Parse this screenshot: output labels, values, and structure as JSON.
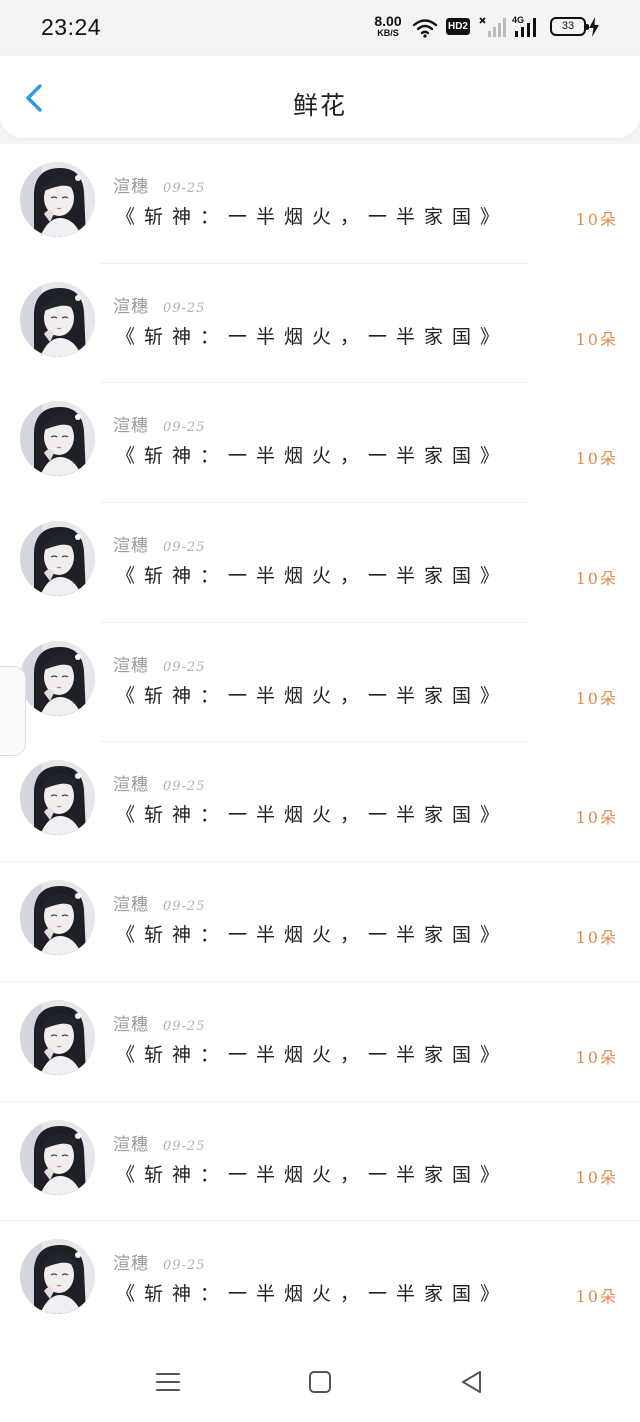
{
  "status_bar": {
    "time": "23:24",
    "net_speed_value": "8.00",
    "net_speed_unit": "KB/S",
    "hd_badge": "HD2",
    "network_type": "4G",
    "battery_level": "33",
    "icons": [
      "wifi-icon",
      "hd-voice-icon",
      "signal-off-icon",
      "signal-4g-icon",
      "battery-icon",
      "charging-icon"
    ]
  },
  "header": {
    "title": "鲜花",
    "back_icon": "chevron-left-icon",
    "accent_color": "#2f97e0"
  },
  "items": [
    {
      "sender": "渲穗",
      "date": "09-25",
      "book": "《斩神：一半烟火，一半家国》",
      "count": "10朵"
    },
    {
      "sender": "渲穗",
      "date": "09-25",
      "book": "《斩神：一半烟火，一半家国》",
      "count": "10朵"
    },
    {
      "sender": "渲穗",
      "date": "09-25",
      "book": "《斩神：一半烟火，一半家国》",
      "count": "10朵"
    },
    {
      "sender": "渲穗",
      "date": "09-25",
      "book": "《斩神：一半烟火，一半家国》",
      "count": "10朵"
    },
    {
      "sender": "渲穗",
      "date": "09-25",
      "book": "《斩神：一半烟火，一半家国》",
      "count": "10朵"
    },
    {
      "sender": "渲穗",
      "date": "09-25",
      "book": "《斩神：一半烟火，一半家国》",
      "count": "10朵"
    },
    {
      "sender": "渲穗",
      "date": "09-25",
      "book": "《斩神：一半烟火，一半家国》",
      "count": "10朵"
    },
    {
      "sender": "渲穗",
      "date": "09-25",
      "book": "《斩神：一半烟火，一半家国》",
      "count": "10朵"
    },
    {
      "sender": "渲穗",
      "date": "09-25",
      "book": "《斩神：一半烟火，一半家国》",
      "count": "10朵"
    },
    {
      "sender": "渲穗",
      "date": "09-25",
      "book": "《斩神：一半烟火，一半家国》",
      "count": "10朵"
    }
  ],
  "colors": {
    "count_color": "#e38a4a",
    "sender_color": "#9b9b9b"
  },
  "nav_bar": {
    "icons": [
      "menu-icon",
      "home-square-icon",
      "back-triangle-icon"
    ]
  }
}
